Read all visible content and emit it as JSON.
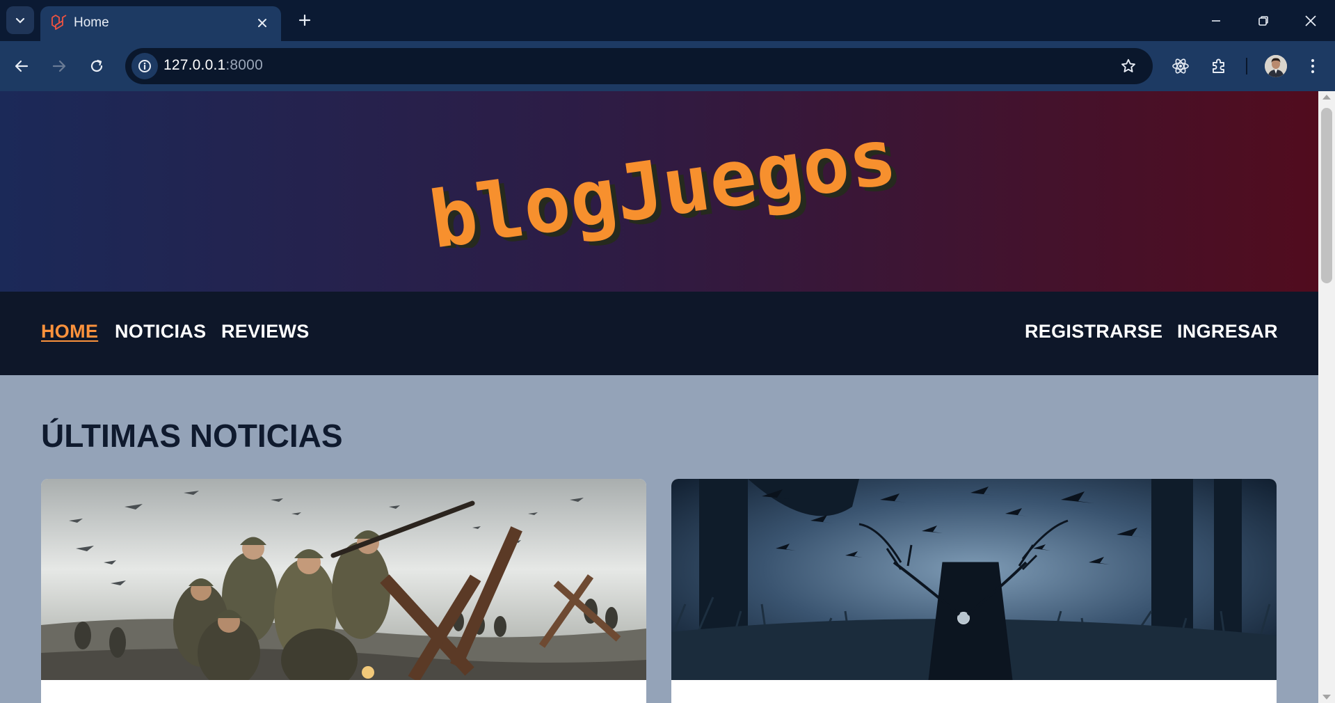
{
  "browser": {
    "tab_title": "Home",
    "url_host": "127.0.0.1",
    "url_port": ":8000",
    "icons": {
      "tab_search": "chevron-down-icon",
      "tab_favicon": "laravel-icon",
      "tab_close": "close-icon",
      "new_tab": "plus-icon",
      "minimize": "minimize-icon",
      "restore": "restore-icon",
      "close_window": "close-icon",
      "back": "arrow-left-icon",
      "forward": "arrow-right-icon",
      "reload": "reload-icon",
      "site_info": "info-icon",
      "bookmark": "star-icon",
      "react_devtools": "react-icon",
      "extensions": "puzzle-icon",
      "profile": "avatar",
      "menu": "kebab-menu-icon"
    }
  },
  "site": {
    "logo_text": "blogJuegos",
    "colors": {
      "accent": "#fb923c",
      "nav_bg": "#0e1729",
      "page_bg": "#94a3b8",
      "hero_left": "#1b2958",
      "hero_right": "#510c1e"
    },
    "nav": {
      "left": [
        "HOME",
        "NOTICIAS",
        "REVIEWS"
      ],
      "right": [
        "REGISTRARSE",
        "INGRESAR"
      ],
      "active": "HOME"
    },
    "section_title": "ÚLTIMAS NOTICIAS",
    "cards": [
      {
        "image": "ww2-soldiers-beach-assault"
      },
      {
        "image": "dark-forest-antlered-creature-ravens"
      }
    ]
  }
}
